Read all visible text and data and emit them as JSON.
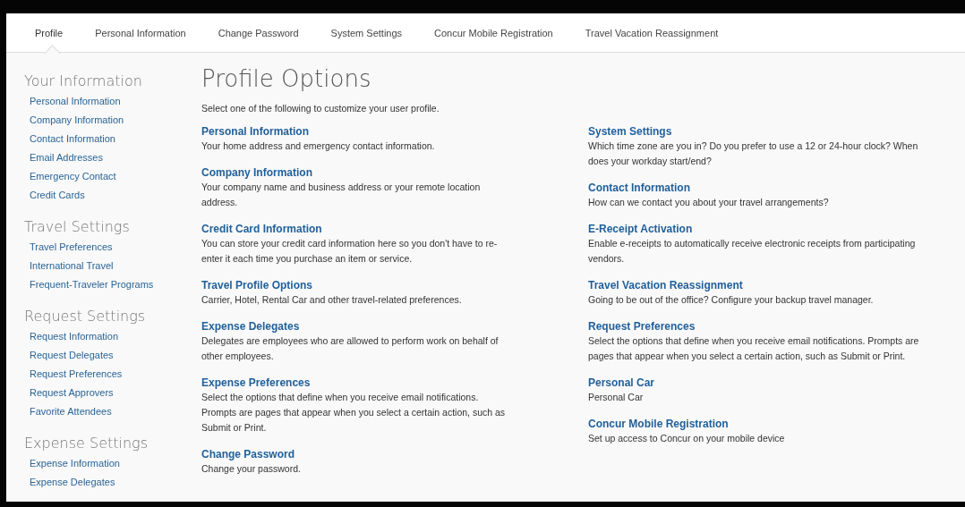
{
  "tabs": [
    {
      "label": "Profile",
      "selected": true
    },
    {
      "label": "Personal Information",
      "selected": false
    },
    {
      "label": "Change Password",
      "selected": false
    },
    {
      "label": "System Settings",
      "selected": false
    },
    {
      "label": "Concur Mobile Registration",
      "selected": false
    },
    {
      "label": "Travel Vacation Reassignment",
      "selected": false
    }
  ],
  "sidebar": {
    "sections": [
      {
        "heading": "Your Information",
        "items": [
          "Personal Information",
          "Company Information",
          "Contact Information",
          "Email Addresses",
          "Emergency Contact",
          "Credit Cards"
        ]
      },
      {
        "heading": "Travel Settings",
        "items": [
          "Travel Preferences",
          "International Travel",
          "Frequent-Traveler Programs"
        ]
      },
      {
        "heading": "Request Settings",
        "items": [
          "Request Information",
          "Request Delegates",
          "Request Preferences",
          "Request Approvers",
          "Favorite Attendees"
        ]
      },
      {
        "heading": "Expense Settings",
        "items": [
          "Expense Information",
          "Expense Delegates"
        ]
      }
    ]
  },
  "main": {
    "title": "Profile Options",
    "intro": "Select one of the following to customize your user profile.",
    "columns": [
      [
        {
          "title": "Personal Information",
          "description": "Your home address and emergency contact information."
        },
        {
          "title": "Company Information",
          "description": "Your company name and business address or your remote location address."
        },
        {
          "title": "Credit Card Information",
          "description": "You can store your credit card information here so you don't have to re-enter it each time you purchase an item or service."
        },
        {
          "title": "Travel Profile Options",
          "description": "Carrier, Hotel, Rental Car and other travel-related preferences."
        },
        {
          "title": "Expense Delegates",
          "description": "Delegates are employees who are allowed to perform work on behalf of other employees."
        },
        {
          "title": "Expense Preferences",
          "description": "Select the options that define when you receive email notifications. Prompts are pages that appear when you select a certain action, such as Submit or Print."
        },
        {
          "title": "Change Password",
          "description": "Change your password."
        }
      ],
      [
        {
          "title": "System Settings",
          "description": "Which time zone are you in? Do you prefer to use a 12 or 24-hour clock? When does your workday start/end?"
        },
        {
          "title": "Contact Information",
          "description": "How can we contact you about your travel arrangements?"
        },
        {
          "title": "E-Receipt Activation",
          "description": "Enable e-receipts to automatically receive electronic receipts from participating vendors."
        },
        {
          "title": "Travel Vacation Reassignment",
          "description": "Going to be out of the office? Configure your backup travel manager."
        },
        {
          "title": "Request Preferences",
          "description": "Select the options that define when you receive email notifications. Prompts are pages that appear when you select a certain action, such as Submit or Print."
        },
        {
          "title": "Personal Car",
          "description": "Personal Car"
        },
        {
          "title": "Concur Mobile Registration",
          "description": "Set up access to Concur on your mobile device"
        }
      ]
    ]
  }
}
